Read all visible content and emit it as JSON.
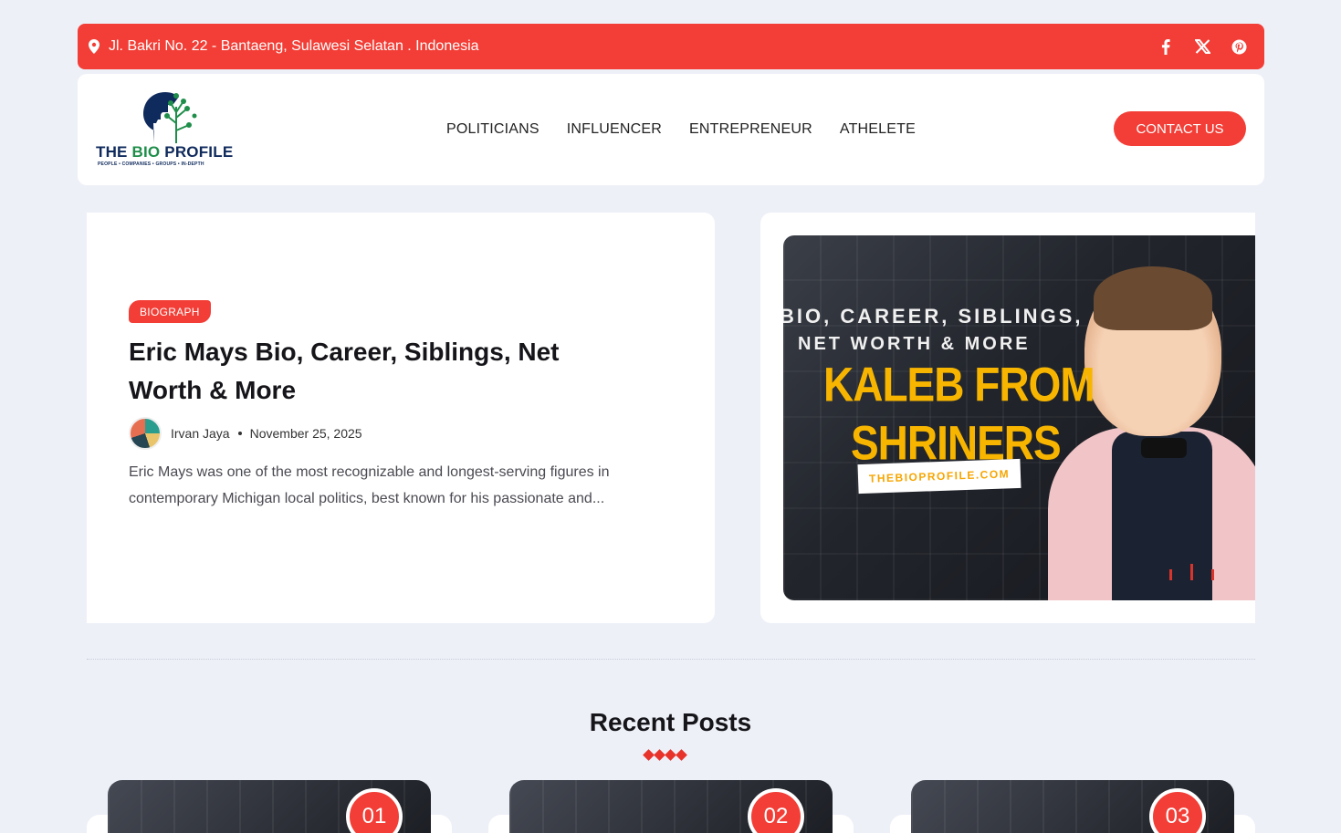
{
  "topbar": {
    "address": "Jl. Bakri No. 22 - Bantaeng, Sulawesi Selatan . Indonesia",
    "social": [
      "facebook-icon",
      "x-icon",
      "pinterest-icon"
    ]
  },
  "header": {
    "logo": {
      "brand_a": "THE ",
      "brand_b": "BIO",
      "brand_c": " PROFILE",
      "tagline": "PEOPLE • COMPANIES • GROUPS • IN-DEPTH"
    },
    "nav": [
      "POLITICIANS",
      "INFLUENCER",
      "ENTREPRENEUR",
      "ATHELETE"
    ],
    "contact_label": "CONTACT US"
  },
  "hero": {
    "category": "BIOGRAPH",
    "title": "Eric Mays Bio, Career, Siblings, Net Worth & More",
    "author": "Irvan Jaya",
    "date": "November 25, 2025",
    "excerpt": "Eric Mays was one of the most recognizable and longest-serving figures in contemporary Michigan local politics, best known for his passionate and...",
    "image_text": {
      "line1": "BIO, CAREER, SIBLINGS,",
      "line2": "NET WORTH & MORE",
      "line3": "KALEB FROM",
      "line4": "SHRINERS",
      "site": "THEBIOPROFILE.COM"
    }
  },
  "recent": {
    "title": "Recent Posts",
    "cards": [
      {
        "number": "01"
      },
      {
        "number": "02"
      },
      {
        "number": "03"
      }
    ]
  },
  "colors": {
    "accent": "#f23e36",
    "background": "#eef0f8",
    "highlight": "#f7b500"
  }
}
